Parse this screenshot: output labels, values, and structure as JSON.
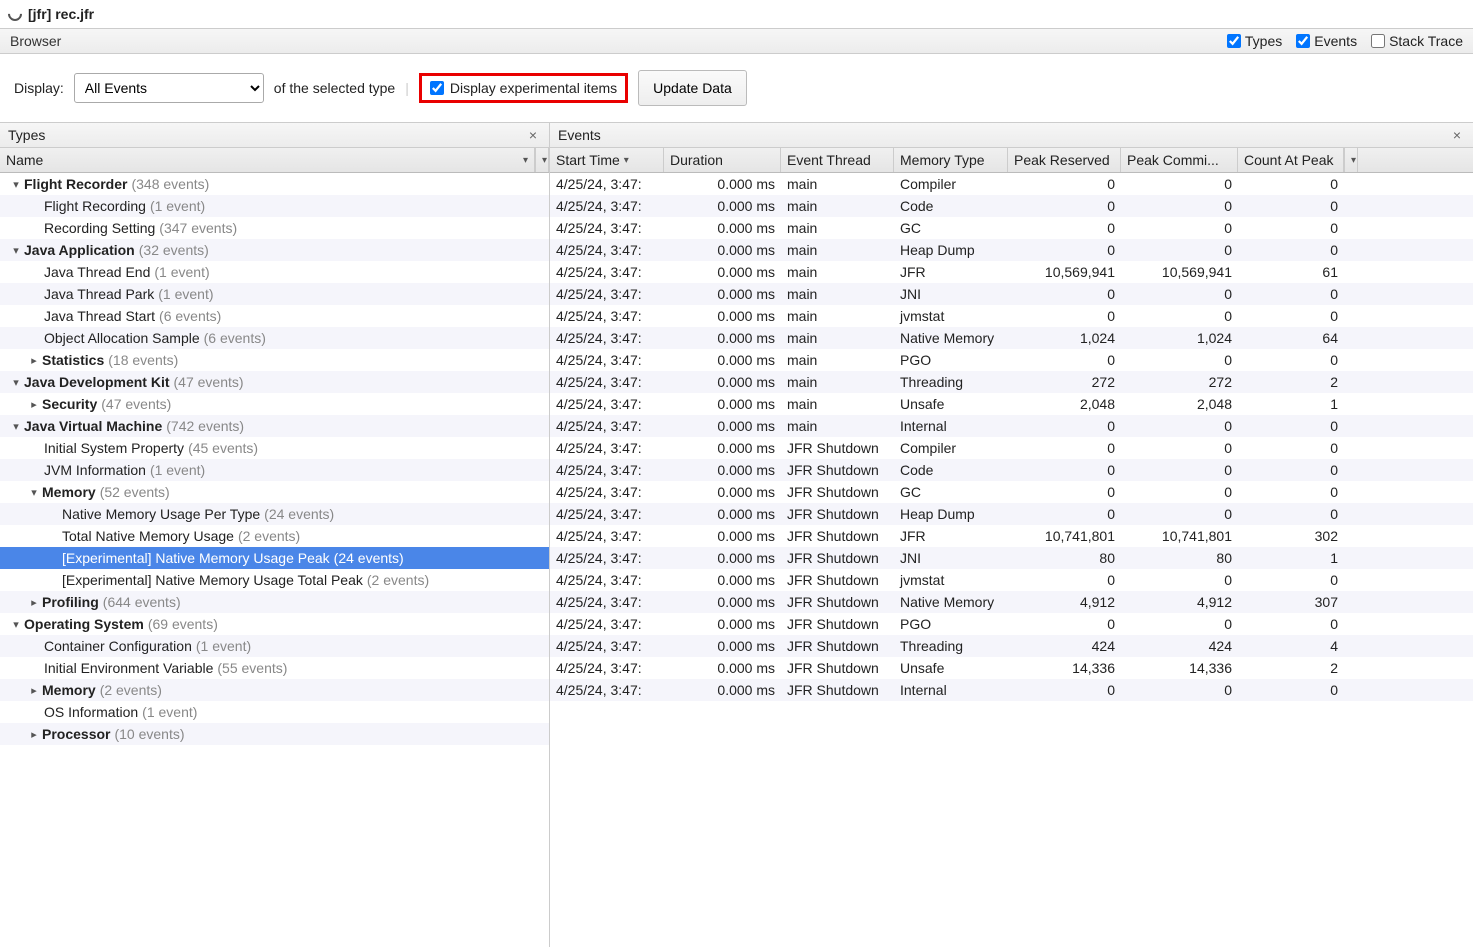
{
  "title": "[jfr] rec.jfr",
  "browser": {
    "label": "Browser",
    "types": "Types",
    "events": "Events",
    "stack": "Stack Trace"
  },
  "toolbar": {
    "display": "Display:",
    "selected": "All Events",
    "suffix": "of the selected type",
    "expcheck": "Display experimental items",
    "update": "Update Data"
  },
  "leftPane": {
    "title": "Types",
    "col": "Name"
  },
  "rightPane": {
    "title": "Events",
    "cols": [
      "Start Time",
      "Duration",
      "Event Thread",
      "Memory Type",
      "Peak Reserved",
      "Peak Commi...",
      "Count At Peak"
    ]
  },
  "tree": [
    {
      "d": 0,
      "t": 1,
      "b": 1,
      "n": "Flight Recorder",
      "c": "(348 events)",
      "a": 0
    },
    {
      "d": 1,
      "t": 0,
      "b": 0,
      "n": "Flight Recording",
      "c": "(1 event)",
      "a": 1
    },
    {
      "d": 1,
      "t": 0,
      "b": 0,
      "n": "Recording Setting",
      "c": "(347 events)",
      "a": 0
    },
    {
      "d": 0,
      "t": 1,
      "b": 1,
      "n": "Java Application",
      "c": "(32 events)",
      "a": 1
    },
    {
      "d": 1,
      "t": 0,
      "b": 0,
      "n": "Java Thread End",
      "c": "(1 event)",
      "a": 0
    },
    {
      "d": 1,
      "t": 0,
      "b": 0,
      "n": "Java Thread Park",
      "c": "(1 event)",
      "a": 1
    },
    {
      "d": 1,
      "t": 0,
      "b": 0,
      "n": "Java Thread Start",
      "c": "(6 events)",
      "a": 0
    },
    {
      "d": 1,
      "t": 0,
      "b": 0,
      "n": "Object Allocation Sample",
      "c": "(6 events)",
      "a": 1
    },
    {
      "d": 1,
      "t": 2,
      "b": 1,
      "n": "Statistics",
      "c": "(18 events)",
      "a": 0
    },
    {
      "d": 0,
      "t": 1,
      "b": 1,
      "n": "Java Development Kit",
      "c": "(47 events)",
      "a": 1
    },
    {
      "d": 1,
      "t": 2,
      "b": 1,
      "n": "Security",
      "c": "(47 events)",
      "a": 0
    },
    {
      "d": 0,
      "t": 1,
      "b": 1,
      "n": "Java Virtual Machine",
      "c": "(742 events)",
      "a": 1
    },
    {
      "d": 1,
      "t": 0,
      "b": 0,
      "n": "Initial System Property",
      "c": "(45 events)",
      "a": 0
    },
    {
      "d": 1,
      "t": 0,
      "b": 0,
      "n": "JVM Information",
      "c": "(1 event)",
      "a": 1
    },
    {
      "d": 1,
      "t": 1,
      "b": 1,
      "n": "Memory",
      "c": "(52 events)",
      "a": 0
    },
    {
      "d": 2,
      "t": 0,
      "b": 0,
      "n": "Native Memory Usage Per Type",
      "c": "(24 events)",
      "a": 1
    },
    {
      "d": 2,
      "t": 0,
      "b": 0,
      "n": "Total Native Memory Usage",
      "c": "(2 events)",
      "a": 0
    },
    {
      "d": 2,
      "t": 0,
      "b": 0,
      "n": "[Experimental] Native Memory Usage Peak",
      "c": "(24 events)",
      "a": 1,
      "sel": 1
    },
    {
      "d": 2,
      "t": 0,
      "b": 0,
      "n": "[Experimental] Native Memory Usage Total Peak",
      "c": "(2 events)",
      "a": 0
    },
    {
      "d": 1,
      "t": 2,
      "b": 1,
      "n": "Profiling",
      "c": "(644 events)",
      "a": 1
    },
    {
      "d": 0,
      "t": 1,
      "b": 1,
      "n": "Operating System",
      "c": "(69 events)",
      "a": 0
    },
    {
      "d": 1,
      "t": 0,
      "b": 0,
      "n": "Container Configuration",
      "c": "(1 event)",
      "a": 1
    },
    {
      "d": 1,
      "t": 0,
      "b": 0,
      "n": "Initial Environment Variable",
      "c": "(55 events)",
      "a": 0
    },
    {
      "d": 1,
      "t": 2,
      "b": 1,
      "n": "Memory",
      "c": "(2 events)",
      "a": 1
    },
    {
      "d": 1,
      "t": 0,
      "b": 0,
      "n": "OS Information",
      "c": "(1 event)",
      "a": 0
    },
    {
      "d": 1,
      "t": 2,
      "b": 1,
      "n": "Processor",
      "c": "(10 events)",
      "a": 1
    }
  ],
  "events": [
    {
      "s": "4/25/24, 3:47:",
      "d": "0.000 ms",
      "t": "main",
      "m": "Compiler",
      "pr": "0",
      "pc": "0",
      "cp": "0",
      "a": 0
    },
    {
      "s": "4/25/24, 3:47:",
      "d": "0.000 ms",
      "t": "main",
      "m": "Code",
      "pr": "0",
      "pc": "0",
      "cp": "0",
      "a": 1
    },
    {
      "s": "4/25/24, 3:47:",
      "d": "0.000 ms",
      "t": "main",
      "m": "GC",
      "pr": "0",
      "pc": "0",
      "cp": "0",
      "a": 0
    },
    {
      "s": "4/25/24, 3:47:",
      "d": "0.000 ms",
      "t": "main",
      "m": "Heap Dump",
      "pr": "0",
      "pc": "0",
      "cp": "0",
      "a": 1
    },
    {
      "s": "4/25/24, 3:47:",
      "d": "0.000 ms",
      "t": "main",
      "m": "JFR",
      "pr": "10,569,941",
      "pc": "10,569,941",
      "cp": "61",
      "a": 0
    },
    {
      "s": "4/25/24, 3:47:",
      "d": "0.000 ms",
      "t": "main",
      "m": "JNI",
      "pr": "0",
      "pc": "0",
      "cp": "0",
      "a": 1
    },
    {
      "s": "4/25/24, 3:47:",
      "d": "0.000 ms",
      "t": "main",
      "m": "jvmstat",
      "pr": "0",
      "pc": "0",
      "cp": "0",
      "a": 0
    },
    {
      "s": "4/25/24, 3:47:",
      "d": "0.000 ms",
      "t": "main",
      "m": "Native Memory",
      "pr": "1,024",
      "pc": "1,024",
      "cp": "64",
      "a": 1
    },
    {
      "s": "4/25/24, 3:47:",
      "d": "0.000 ms",
      "t": "main",
      "m": "PGO",
      "pr": "0",
      "pc": "0",
      "cp": "0",
      "a": 0
    },
    {
      "s": "4/25/24, 3:47:",
      "d": "0.000 ms",
      "t": "main",
      "m": "Threading",
      "pr": "272",
      "pc": "272",
      "cp": "2",
      "a": 1
    },
    {
      "s": "4/25/24, 3:47:",
      "d": "0.000 ms",
      "t": "main",
      "m": "Unsafe",
      "pr": "2,048",
      "pc": "2,048",
      "cp": "1",
      "a": 0
    },
    {
      "s": "4/25/24, 3:47:",
      "d": "0.000 ms",
      "t": "main",
      "m": "Internal",
      "pr": "0",
      "pc": "0",
      "cp": "0",
      "a": 1
    },
    {
      "s": "4/25/24, 3:47:",
      "d": "0.000 ms",
      "t": "JFR Shutdown",
      "m": "Compiler",
      "pr": "0",
      "pc": "0",
      "cp": "0",
      "a": 0
    },
    {
      "s": "4/25/24, 3:47:",
      "d": "0.000 ms",
      "t": "JFR Shutdown",
      "m": "Code",
      "pr": "0",
      "pc": "0",
      "cp": "0",
      "a": 1
    },
    {
      "s": "4/25/24, 3:47:",
      "d": "0.000 ms",
      "t": "JFR Shutdown",
      "m": "GC",
      "pr": "0",
      "pc": "0",
      "cp": "0",
      "a": 0
    },
    {
      "s": "4/25/24, 3:47:",
      "d": "0.000 ms",
      "t": "JFR Shutdown",
      "m": "Heap Dump",
      "pr": "0",
      "pc": "0",
      "cp": "0",
      "a": 1
    },
    {
      "s": "4/25/24, 3:47:",
      "d": "0.000 ms",
      "t": "JFR Shutdown",
      "m": "JFR",
      "pr": "10,741,801",
      "pc": "10,741,801",
      "cp": "302",
      "a": 0
    },
    {
      "s": "4/25/24, 3:47:",
      "d": "0.000 ms",
      "t": "JFR Shutdown",
      "m": "JNI",
      "pr": "80",
      "pc": "80",
      "cp": "1",
      "a": 1
    },
    {
      "s": "4/25/24, 3:47:",
      "d": "0.000 ms",
      "t": "JFR Shutdown",
      "m": "jvmstat",
      "pr": "0",
      "pc": "0",
      "cp": "0",
      "a": 0
    },
    {
      "s": "4/25/24, 3:47:",
      "d": "0.000 ms",
      "t": "JFR Shutdown",
      "m": "Native Memory",
      "pr": "4,912",
      "pc": "4,912",
      "cp": "307",
      "a": 1
    },
    {
      "s": "4/25/24, 3:47:",
      "d": "0.000 ms",
      "t": "JFR Shutdown",
      "m": "PGO",
      "pr": "0",
      "pc": "0",
      "cp": "0",
      "a": 0
    },
    {
      "s": "4/25/24, 3:47:",
      "d": "0.000 ms",
      "t": "JFR Shutdown",
      "m": "Threading",
      "pr": "424",
      "pc": "424",
      "cp": "4",
      "a": 1
    },
    {
      "s": "4/25/24, 3:47:",
      "d": "0.000 ms",
      "t": "JFR Shutdown",
      "m": "Unsafe",
      "pr": "14,336",
      "pc": "14,336",
      "cp": "2",
      "a": 0
    },
    {
      "s": "4/25/24, 3:47:",
      "d": "0.000 ms",
      "t": "JFR Shutdown",
      "m": "Internal",
      "pr": "0",
      "pc": "0",
      "cp": "0",
      "a": 1
    }
  ]
}
